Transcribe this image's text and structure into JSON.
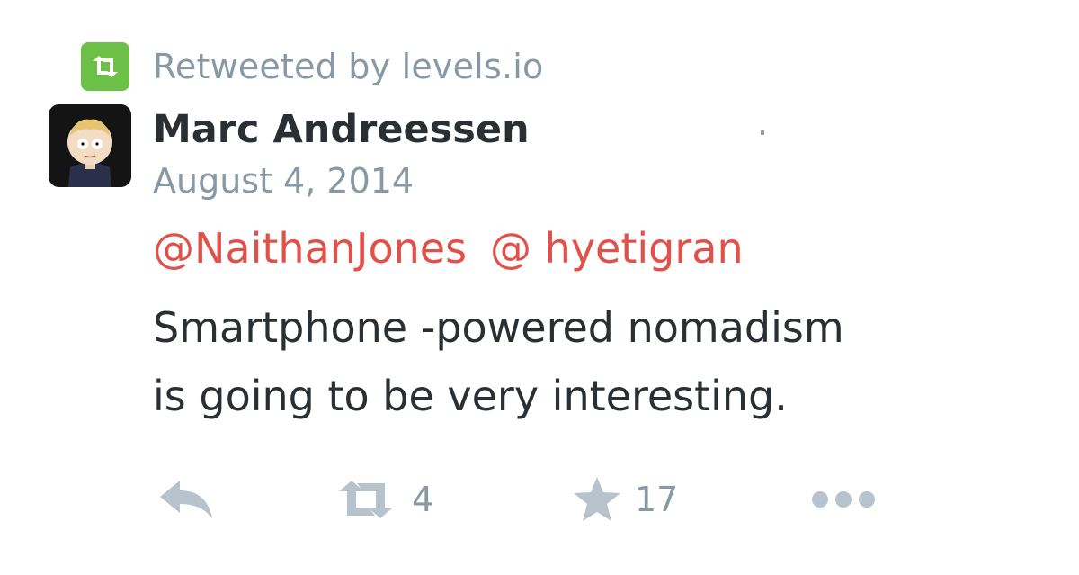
{
  "retweet_banner": {
    "icon": "retweet-icon",
    "text": "Retweeted by levels.io",
    "badge_color": "#6cbf47"
  },
  "tweet": {
    "author_name": "Marc Andreessen",
    "date": "August 4, 2014",
    "mentions": [
      "@NaithanJones",
      "@ hyetigran"
    ],
    "body_line1": "Smartphone -powered nomadism",
    "body_line2": "is going to be very interesting."
  },
  "actions": {
    "reply": {
      "icon": "reply-icon"
    },
    "retweet": {
      "icon": "retweet-icon",
      "count": "4"
    },
    "favorite": {
      "icon": "star-icon",
      "count": "17"
    },
    "more": {
      "icon": "more-dots-icon"
    }
  },
  "colors": {
    "mention": "#e0514a",
    "meta_gray": "#8899a6",
    "icon_gray": "#b6c3cd",
    "text": "#292f33"
  }
}
